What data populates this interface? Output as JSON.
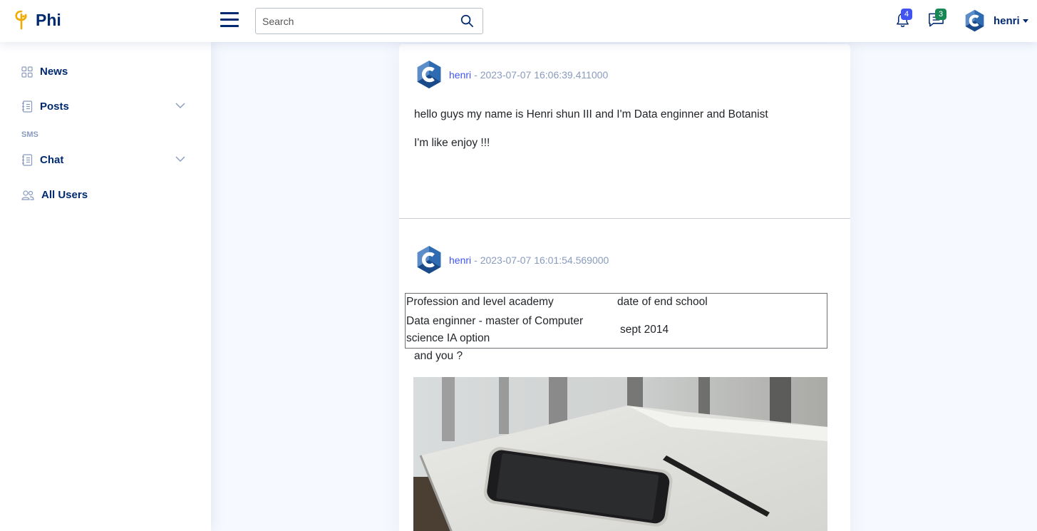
{
  "header": {
    "app_name": "Phi",
    "search_placeholder": "Search",
    "notifications_count": "4",
    "messages_count": "3",
    "user_name": "henri"
  },
  "sidebar": {
    "items": [
      {
        "label": "News"
      },
      {
        "label": "Posts"
      },
      {
        "label": "Chat"
      },
      {
        "label": "All Users"
      }
    ],
    "section_heading": "SMS"
  },
  "posts": [
    {
      "author": "henri",
      "date": "- 2023-07-07 16:06:39.411000",
      "lines": [
        "hello guys my name is Henri shun III and I'm Data enginner and Botanist",
        "I'm like enjoy !!!"
      ]
    },
    {
      "author": "henri",
      "date": "- 2023-07-07 16:01:54.569000",
      "table": {
        "header": [
          "Profession and level academy",
          "date of end school"
        ],
        "row_col1_line1": "Data enginner - master of Computer",
        "row_col1_line2": "science IA option",
        "row_col2": "sept 2014"
      },
      "text": "and you ?"
    }
  ],
  "colors": {
    "brand": "#012970",
    "accent": "#4154f1",
    "muted": "#899bbd",
    "background": "#f6f9ff"
  }
}
